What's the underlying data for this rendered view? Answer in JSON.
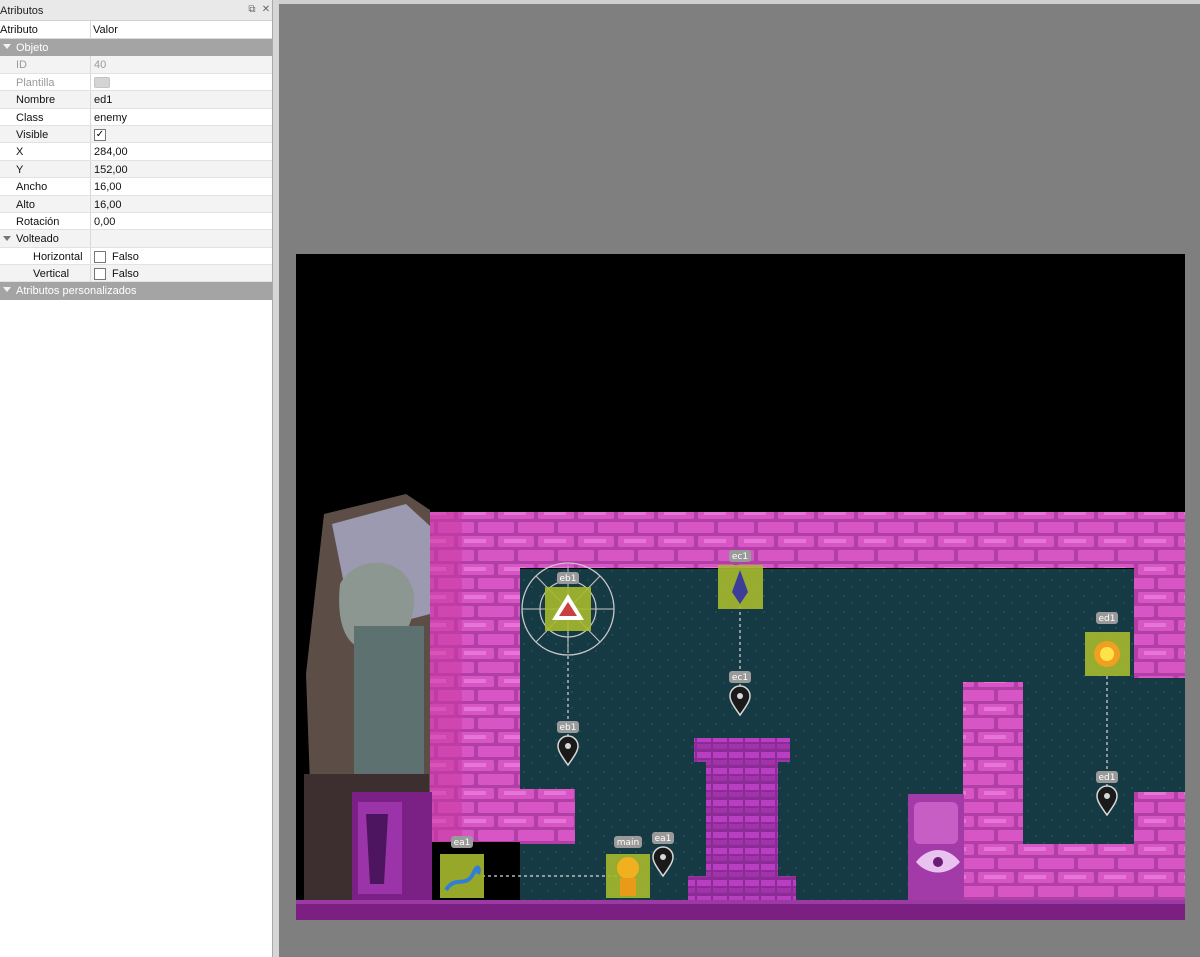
{
  "panel": {
    "title": "Atributos",
    "float_icon": "float-icon",
    "close_icon": "close-icon",
    "col_attr": "Atributo",
    "col_value": "Valor"
  },
  "groups": {
    "object": "Objeto",
    "custom": "Atributos personalizados"
  },
  "props": {
    "id_key": "ID",
    "id_val": "40",
    "template_key": "Plantilla",
    "name_key": "Nombre",
    "name_val": "ed1",
    "class_key": "Class",
    "class_val": "enemy",
    "visible_key": "Visible",
    "visible_check": "✓",
    "x_key": "X",
    "x_val": "284,00",
    "y_key": "Y",
    "y_val": "152,00",
    "width_key": "Ancho",
    "width_val": "16,00",
    "height_key": "Alto",
    "height_val": "16,00",
    "rotation_key": "Rotación",
    "rotation_val": "0,00",
    "flip_key": "Volteado",
    "horizontal_key": "Horizontal",
    "horizontal_val": "Falso",
    "vertical_key": "Vertical",
    "vertical_val": "Falso"
  },
  "map_labels": {
    "eb1_top": "eb1",
    "ec1_top": "ec1",
    "ed1_top": "ed1",
    "ec1_pin": "ec1",
    "eb1_pin": "eb1",
    "ed1_pin": "ed1",
    "ea1_obj": "ea1",
    "main": "main",
    "ea1_pin": "ea1"
  },
  "colors": {
    "brick": "#d24fc0",
    "brick_dark": "#8a2a80",
    "bg_cave": "#163a44",
    "floor": "#7b1f83",
    "object_fill": "#a6b92e"
  }
}
